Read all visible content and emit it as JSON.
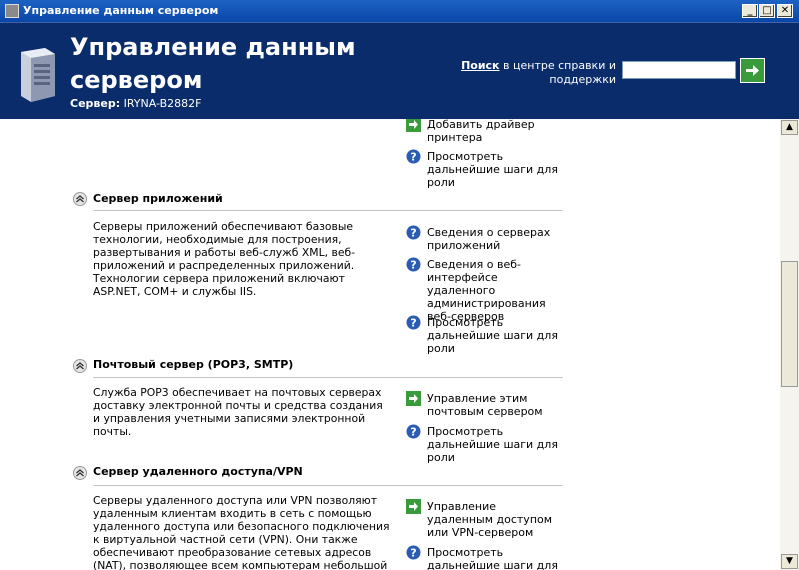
{
  "window": {
    "title": "Управление данным сервером",
    "buttons": {
      "minimize": "_",
      "maximize": "□",
      "close": "✕"
    }
  },
  "header": {
    "title": "Управление данным сервером",
    "server_label": "Сервер:",
    "server_name": "IRYNA-B2882F",
    "search_label_bold": "Поиск",
    "search_label_rest": " в центре справки и поддержки",
    "search_value": ""
  },
  "top_links": [
    {
      "icon": "green-arrow-icon",
      "text": "Добавить драйвер принтера"
    },
    {
      "icon": "help-icon",
      "text": "Просмотреть дальнейшие шаги для роли"
    }
  ],
  "sections": [
    {
      "title": "Сервер приложений",
      "description": "Серверы приложений обеспечивают базовые технологии, необходимые для построения, развертывания и работы веб-служб XML, веб-приложений и распределенных приложений. Технологии сервера приложений включают ASP.NET, COM+ и службы IIS.",
      "links": [
        {
          "icon": "help-icon",
          "text": "Сведения о серверах приложений"
        },
        {
          "icon": "help-icon",
          "text": "Сведения о веб-интерфейсе удаленного администрирования веб-серверов"
        },
        {
          "icon": "help-icon",
          "text": "Просмотреть дальнейшие шаги для роли"
        }
      ]
    },
    {
      "title": "Почтовый сервер (POP3, SMTP)",
      "description": "Служба POP3 обеспечивает на почтовых серверах доставку электронной почты и средства создания и управления учетными записями электронной почты.",
      "links": [
        {
          "icon": "green-arrow-icon",
          "text": "Управление этим почтовым сервером"
        },
        {
          "icon": "help-icon",
          "text": "Просмотреть дальнейшие шаги для роли"
        }
      ]
    },
    {
      "title": "Сервер удаленного доступа/VPN",
      "description": "Серверы удаленного доступа или VPN позволяют удаленным клиентам входить в сеть с помощью удаленного доступа или безопасного подключения к виртуальной частной сети (VPN). Они также обеспечивают преобразование сетевых адресов (NAT), позволяющее всем компьютерам небольшой сети",
      "links": [
        {
          "icon": "green-arrow-icon",
          "text": "Управление удаленным доступом или VPN-сервером"
        },
        {
          "icon": "help-icon",
          "text": "Просмотреть дальнейшие шаги для роли"
        }
      ]
    }
  ],
  "colors": {
    "header_bg": "#0a2c6b",
    "titlebar": "#0a47a8",
    "help_icon": "#2a5bb5",
    "arrow_icon": "#3a9b3a"
  }
}
